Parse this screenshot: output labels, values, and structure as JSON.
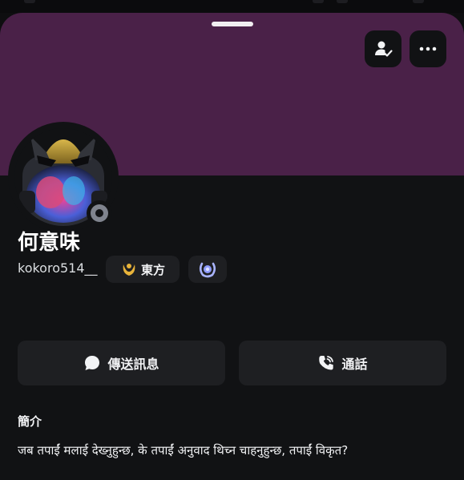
{
  "profile": {
    "display_name": "何意味",
    "username": "kokoro514__",
    "guild_tag": {
      "label": "東方",
      "icon": "moon-crescent-icon"
    },
    "badge": {
      "icon": "laurel-badge-icon"
    },
    "status": "offline"
  },
  "actions": {
    "message_label": "傳送訊息",
    "call_label": "通話"
  },
  "bio": {
    "title": "簡介",
    "text": "जब तपाईं मलाई देख्नुहुन्छ, के तपाईं अनुवाद थिच्न चाहनुहुन्छ, तपाईं विकृत?"
  },
  "colors": {
    "banner": "#4a2148",
    "background": "#111214",
    "button": "#1e1f22",
    "status_offline": "#80848e"
  }
}
